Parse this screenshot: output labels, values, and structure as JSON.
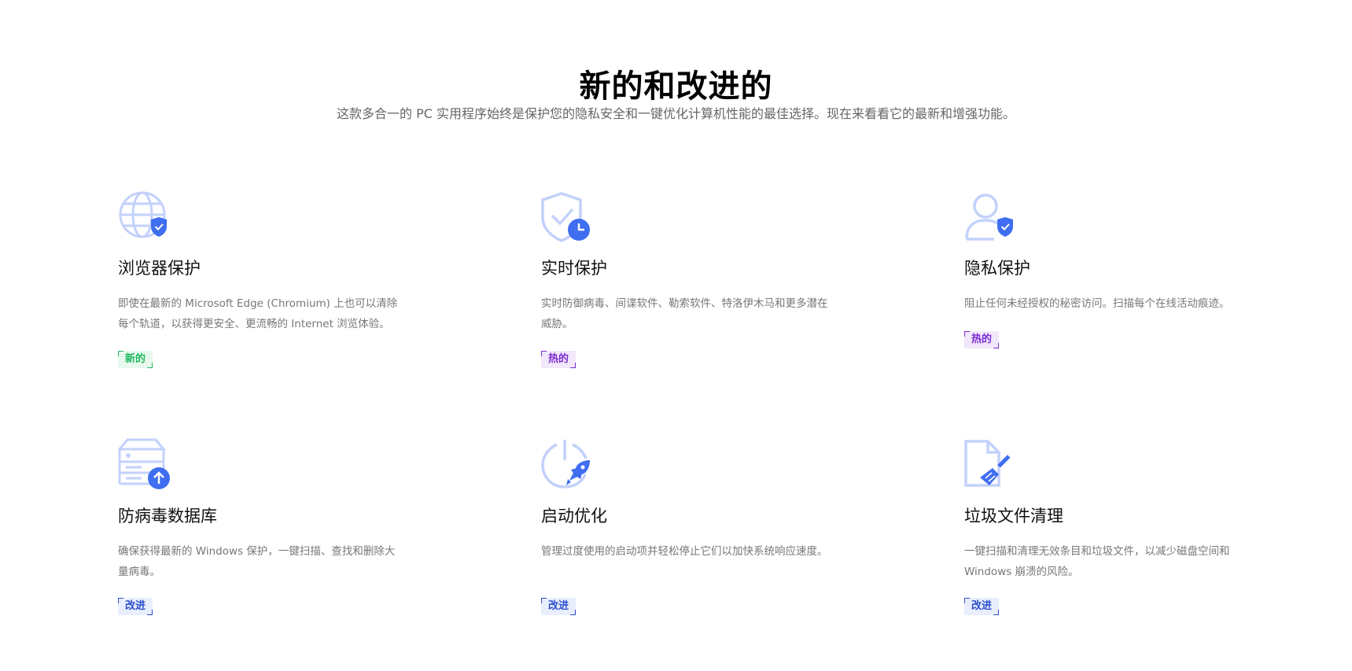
{
  "section": {
    "title": "新的和改进的",
    "subtitle": "这款多合一的 PC 实用程序始终是保护您的隐私安全和一键优化计算机性能的最佳选择。现在来看看它的最新和增强功能。"
  },
  "colors": {
    "icon_light": "#c3d1fb",
    "icon_accent": "#3f6ef0",
    "badge_new": "#1fb85e",
    "badge_hot": "#7a2bd1",
    "badge_improved": "#2c4fcf"
  },
  "features": [
    {
      "icon": "globe-shield-icon",
      "title": "浏览器保护",
      "description": "即使在最新的 Microsoft Edge (Chromium) 上也可以清除每个轨道，以获得更安全、更流畅的 Internet 浏览体验。",
      "badge": "新的",
      "badge_type": "new"
    },
    {
      "icon": "shield-clock-icon",
      "title": "实时保护",
      "description": "实时防御病毒、间谍软件、勒索软件、特洛伊木马和更多潜在威胁。",
      "badge": "热的",
      "badge_type": "hot"
    },
    {
      "icon": "user-shield-icon",
      "title": "隐私保护",
      "description": "阻止任何未经授权的秘密访问。扫描每个在线活动痕迹。",
      "badge": "热的",
      "badge_type": "hot"
    },
    {
      "icon": "database-update-icon",
      "title": "防病毒数据库",
      "description": "确保获得最新的 Windows 保护，一键扫描、查找和删除大量病毒。",
      "badge": "改进",
      "badge_type": "improved"
    },
    {
      "icon": "power-rocket-icon",
      "title": "启动优化",
      "description": "管理过度使用的启动项并轻松停止它们以加快系统响应速度。",
      "badge": "改进",
      "badge_type": "improved"
    },
    {
      "icon": "file-broom-icon",
      "title": "垃圾文件清理",
      "description": "一键扫描和清理无效条目和垃圾文件，以减少磁盘空间和 Windows 崩溃的风险。",
      "badge": "改进",
      "badge_type": "improved"
    }
  ]
}
